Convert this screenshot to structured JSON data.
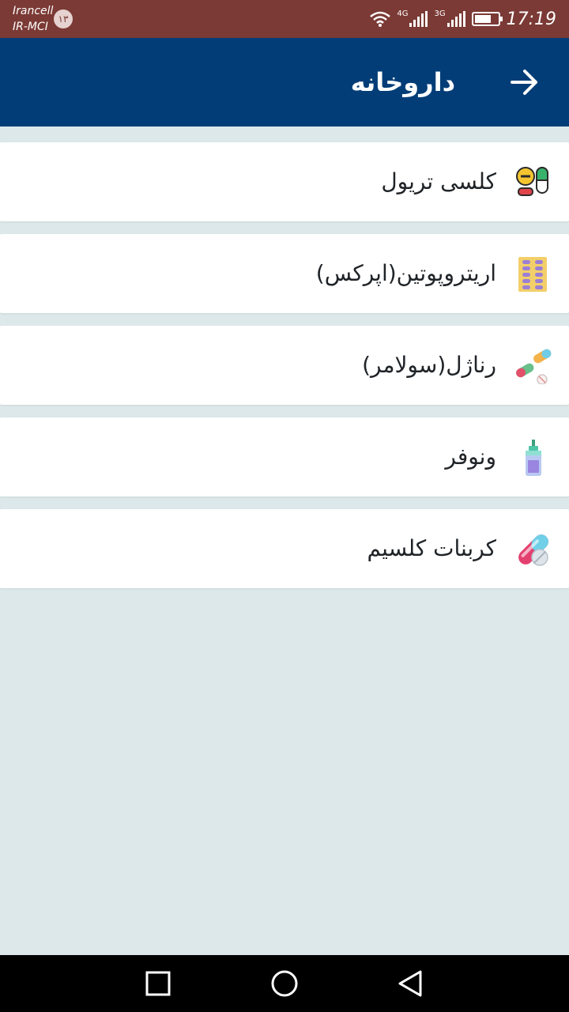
{
  "status_bar": {
    "carrier_line1": "Irancell",
    "carrier_line2": "IR-MCI",
    "sim_badge": "۱۳",
    "network_1": "4G",
    "network_2": "3G",
    "time": "17:19"
  },
  "app_bar": {
    "title": "داروخانه",
    "back_icon": "arrow-right-icon"
  },
  "medicines": [
    {
      "label": "کلسی تریول",
      "icon": "pills-icon"
    },
    {
      "label": "اریتروپوتین(اپرکس)",
      "icon": "blister-pack-icon"
    },
    {
      "label": "رناژل(سولامر)",
      "icon": "capsules-icon"
    },
    {
      "label": "ونوفر",
      "icon": "vial-icon"
    },
    {
      "label": "کربنات کلسیم",
      "icon": "capsule-tablet-icon"
    }
  ],
  "nav_bar": {
    "recent_icon": "square-icon",
    "home_icon": "circle-icon",
    "back_icon": "triangle-back-icon"
  },
  "colors": {
    "status_bar": "#7b3a35",
    "app_bar": "#033d77",
    "background": "#dce8e9"
  }
}
